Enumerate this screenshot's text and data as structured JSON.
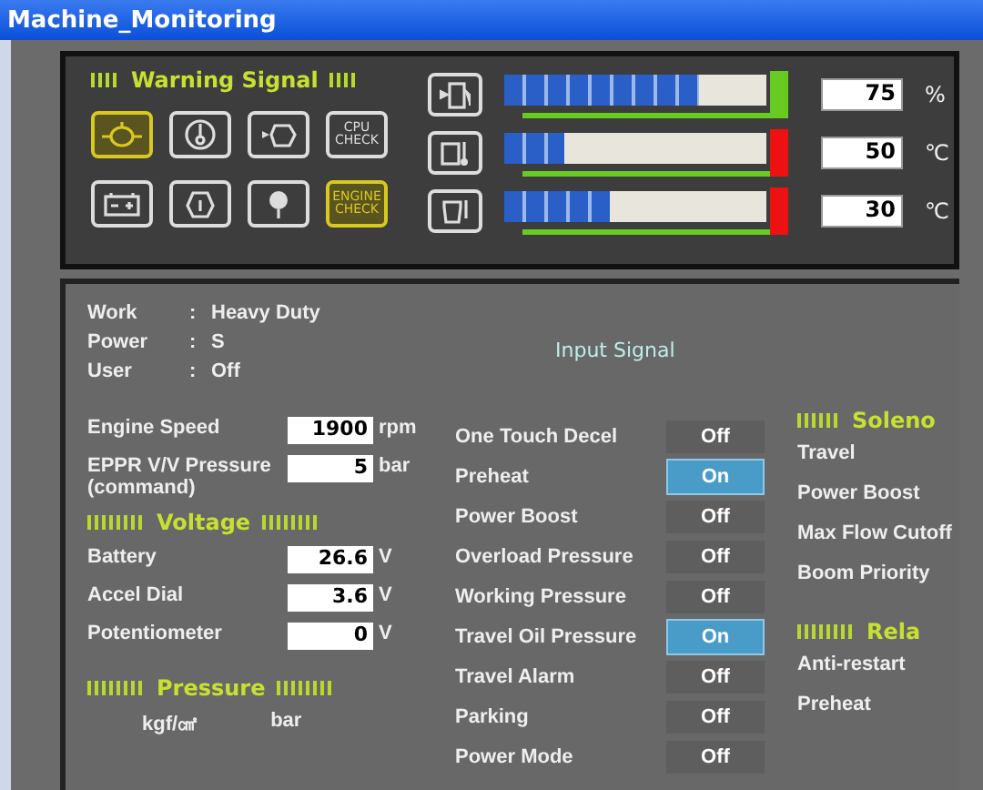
{
  "window": {
    "title": "Machine_Monitoring"
  },
  "warning_signal": {
    "title": "Warning Signal",
    "icons": [
      {
        "kind": "oil-pressure",
        "lit": true
      },
      {
        "kind": "coolant",
        "lit": false
      },
      {
        "kind": "fuel-filter",
        "lit": false
      },
      {
        "kind": "text",
        "text": "CPU\nCHECK",
        "lit": false
      },
      {
        "kind": "battery",
        "lit": false
      },
      {
        "kind": "air-filter",
        "lit": false
      },
      {
        "kind": "preheat",
        "lit": false
      },
      {
        "kind": "text",
        "text": "ENGINE\nCHECK",
        "lit": true
      }
    ]
  },
  "gauges": [
    {
      "kind": "fuel",
      "level": 0.74,
      "color": "#66cc22",
      "reading": "75",
      "unit": "%"
    },
    {
      "kind": "coolant",
      "level": 0.23,
      "color": "#ee1111",
      "reading": "50",
      "unit": "℃"
    },
    {
      "kind": "hydraulic",
      "level": 0.4,
      "color": "#ee1111",
      "reading": "30",
      "unit": "℃"
    }
  ],
  "info": [
    {
      "label": "Work",
      "sep": ":",
      "value": "Heavy Duty"
    },
    {
      "label": "Power",
      "sep": ":",
      "value": "S"
    },
    {
      "label": "User",
      "sep": ":",
      "value": "Off"
    }
  ],
  "input_signal_title": "Input Signal",
  "readings": [
    {
      "label": "Engine Speed",
      "value": "1900",
      "unit": "rpm"
    },
    {
      "label": "EPPR V/V Pressure\n(command)",
      "value": "5",
      "unit": "bar"
    }
  ],
  "voltage": {
    "title": "Voltage",
    "rows": [
      {
        "label": "Battery",
        "value": "26.6",
        "unit": "V"
      },
      {
        "label": "Accel Dial",
        "value": "3.6",
        "unit": "V"
      },
      {
        "label": "Potentiometer",
        "value": "0",
        "unit": "V"
      }
    ]
  },
  "pressure": {
    "title": "Pressure",
    "units": [
      "kgf/㎠",
      "bar"
    ]
  },
  "inputs": [
    {
      "label": "One Touch Decel",
      "value": "Off",
      "on": false
    },
    {
      "label": "Preheat",
      "value": "On",
      "on": true
    },
    {
      "label": "Power Boost",
      "value": "Off",
      "on": false
    },
    {
      "label": "Overload Pressure",
      "value": "Off",
      "on": false
    },
    {
      "label": "Working Pressure",
      "value": "Off",
      "on": false
    },
    {
      "label": "Travel Oil Pressure",
      "value": "On",
      "on": true
    },
    {
      "label": "Travel Alarm",
      "value": "Off",
      "on": false
    },
    {
      "label": "Parking",
      "value": "Off",
      "on": false
    },
    {
      "label": "Power Mode",
      "value": "Off",
      "on": false
    }
  ],
  "solenoid": {
    "title": "Soleno",
    "items": [
      "Travel",
      "Power Boost",
      "Max Flow Cutoff",
      "Boom Priority"
    ]
  },
  "relay": {
    "title": "Rela",
    "items": [
      "Anti-restart",
      "Preheat"
    ]
  }
}
